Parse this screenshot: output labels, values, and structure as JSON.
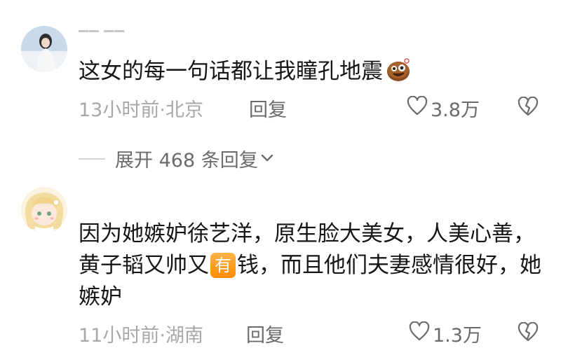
{
  "comments": [
    {
      "text": "这女的每一句话都让我瞳孔地震",
      "emoji": "cookie-face-emoji",
      "meta": "13小时前·北京",
      "reply_label": "回复",
      "likes": "3.8万",
      "expand_label": "展开 468 条回复"
    },
    {
      "text_part1": "因为她嫉妒徐艺洋，原生脸大美女，人美心善，黄子韬又帅又",
      "badge": "有",
      "text_part2": "钱，而且他们夫妻感情很好，她嫉妒",
      "meta": "11小时前·湖南",
      "reply_label": "回复",
      "likes": "1.3万"
    }
  ],
  "icons": {
    "heart": "heart-outline-icon",
    "dislike": "broken-heart-icon",
    "chevron": "chevron-down-icon"
  },
  "colors": {
    "text": "#161616",
    "meta": "#a8a8a8",
    "action": "#6b6b6b",
    "badge": "#ff9a1f"
  }
}
